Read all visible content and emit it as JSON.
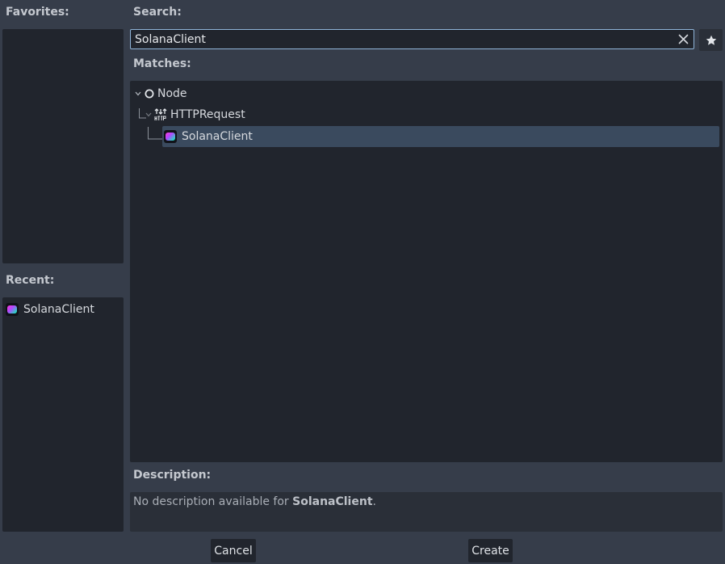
{
  "favorites": {
    "label": "Favorites:"
  },
  "recent": {
    "label": "Recent:",
    "items": [
      {
        "label": "SolanaClient",
        "icon": "solana-client-icon"
      }
    ]
  },
  "search": {
    "label": "Search:",
    "value": "SolanaClient",
    "clear_icon": "close-icon",
    "favorite_icon": "star-icon"
  },
  "matches": {
    "label": "Matches:",
    "tree": [
      {
        "label": "Node",
        "icon": "node-circle-icon",
        "depth": 0,
        "expanded": true
      },
      {
        "label": "HTTPRequest",
        "icon": "http-request-icon",
        "depth": 1,
        "expanded": true
      },
      {
        "label": "SolanaClient",
        "icon": "solana-client-icon",
        "depth": 2,
        "selected": true
      }
    ]
  },
  "description": {
    "label": "Description:",
    "prefix": "No description available for ",
    "name": "SolanaClient",
    "suffix": "."
  },
  "buttons": {
    "cancel": "Cancel",
    "create": "Create"
  },
  "colors": {
    "background": "#363d4a",
    "panel": "#21252d",
    "selection": "#3a4a5e",
    "focus_border": "#8fb4d8"
  }
}
